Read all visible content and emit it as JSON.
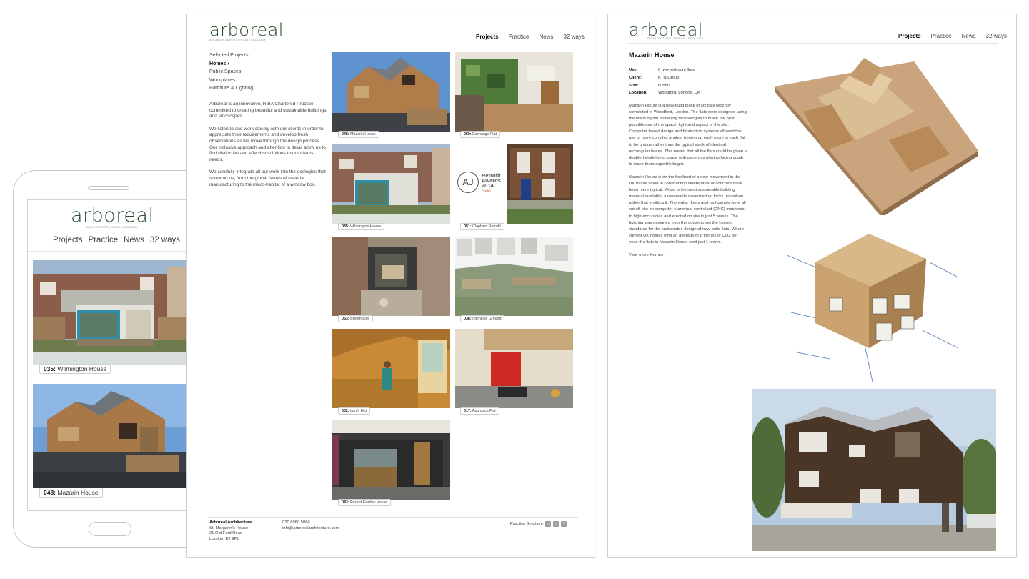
{
  "brand": {
    "logo": "arboreal",
    "tagline": "ARCHITECTURE | DESIGN | ECOLOGY"
  },
  "nav": {
    "projects": "Projects",
    "practice": "Practice",
    "news": "News",
    "ways": "32 ways"
  },
  "mobile": {
    "items": [
      {
        "num": "035:",
        "name": "Wilmington House"
      },
      {
        "num": "048:",
        "name": "Mazarin House"
      }
    ]
  },
  "listing": {
    "menu": [
      "Selected Projects",
      "Homes ›",
      "Public Spaces",
      "Workplaces",
      "Furniture & Lighting"
    ],
    "intro": [
      "Arboreal is an innovative, RIBA Chartered Practice committed to creating beautiful and sustainable buildings and landscapes.",
      "We listen to and work closely with our clients in order to appreciate their requirements and develop fresh observations as we move through the design process. Our inclusive approach and attention to detail allow us to find distinctive and effective solutions to our clients' needs.",
      "We carefully integrate all our work into the ecologies that surround us; from the global issues of material manufacturing to the micro-habitat of a window box."
    ],
    "projects": [
      {
        "num": "048:",
        "name": "Mazarin House"
      },
      {
        "num": "050:",
        "name": "Exchange Flat"
      },
      {
        "num": "035:",
        "name": "Wilmington House"
      },
      {
        "num": "051:",
        "name": "Clapham Retrofit"
      },
      {
        "num": "053:",
        "name": "Brenthouse"
      },
      {
        "num": "038:",
        "name": "Intensive Ground"
      },
      {
        "num": "002:",
        "name": "Larch Hut"
      },
      {
        "num": "017:",
        "name": "Approach Flat"
      },
      {
        "num": "043:",
        "name": "Pocket Garden House"
      }
    ],
    "award": {
      "aj": "AJ",
      "line1": "Retrofit",
      "line2": "Awards",
      "line3": "2014",
      "line4": "Finalist"
    },
    "footer": {
      "company": "Arboreal Architecture",
      "address": [
        "St. Margaret's House",
        "21 Old Ford Road",
        "London, E2 9PL"
      ],
      "phone": "020 8980 5066",
      "email": "info@arborealarchitecture.com",
      "brochure": "Practice Brochure",
      "social": [
        "in",
        "t",
        "f"
      ]
    }
  },
  "detail": {
    "title": "Mazarin House",
    "facts": [
      {
        "label": "Use:",
        "value": "6 two-bedroom flats"
      },
      {
        "label": "Client:",
        "value": "KTN Group"
      },
      {
        "label": "Size:",
        "value": "605m²"
      },
      {
        "label": "Location:",
        "value": "Woodford, London, UK"
      }
    ],
    "para1": "Mazarin House is a new-build block of six flats recently completed in Woodford, London. The flats were designed using the latest digital modelling technologies to make the best possible use of the space, light and aspect of the site. Computer based design and fabrication systems allowed the use of more complex angles, freeing up each room in each flat to be unique rather than the typical stack of identical rectangular boxes. This meant that all the flats could be given a double-height living space with generous glazing facing south to make them superbly bright.",
    "para2": "Mazarin House is on the forefront of a new movement in the UK to use wood in construction where brick or concrete have been more typical. Wood is the most sustainable building material available; a renewable resource that locks up carbon rather that emitting it. The walls, floors and roof panels were all cut off-site on computer-numerical-controlled (CNC) machines to high accuracies and erected on site in just 5 weeks. The building was designed from the outset to set the highest standards for the sustainable design of new-build flats. Where current UK homes emit an average of 6 tonnes of CO2 per year, the flats in Mazarin House emit just 1 tonne.",
    "more": "View more Homes ›"
  }
}
